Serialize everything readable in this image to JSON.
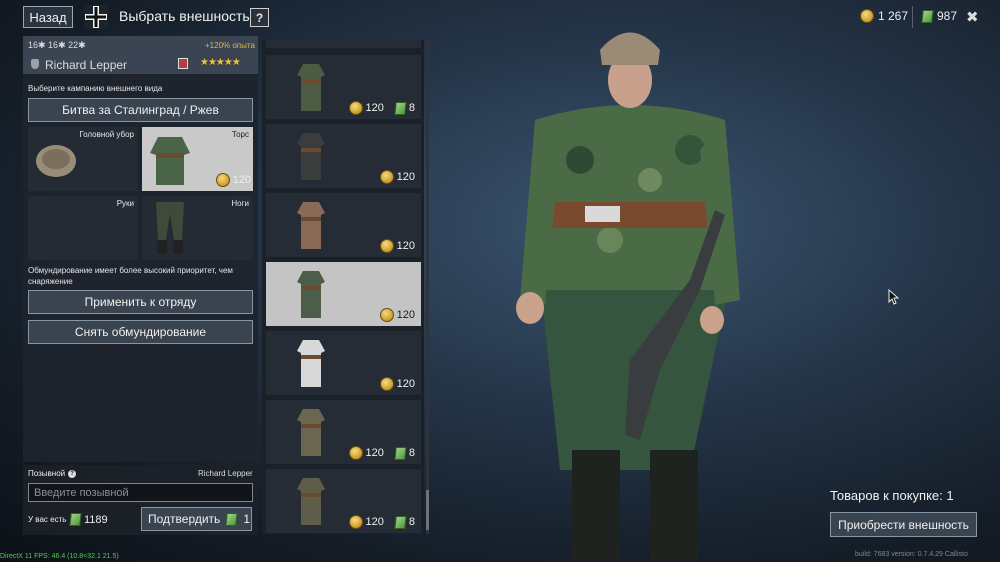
{
  "header": {
    "back_label": "Назад",
    "title": "Выбрать внешность",
    "help_label": "?",
    "silver_amount": "1 267",
    "gold_amount": "987",
    "close_label": "✖"
  },
  "soldier": {
    "stats": "16✱ 16✱ 22✱",
    "bonus": "+120% опыта",
    "name": "Richard Lepper",
    "stars": "★★★★★"
  },
  "campaign": {
    "label": "Выберите кампанию внешнего вида",
    "selected": "Битва за Сталинград / Ржев"
  },
  "slots": {
    "headgear": "Головной убор",
    "torso": "Торс",
    "torso_price": "120",
    "hands": "Руки",
    "legs": "Ноги"
  },
  "priority_note": "Обмундирование имеет более высокий приоритет, чем снаряжение",
  "actions": {
    "apply": "Применить к отряду",
    "remove": "Снять обмундирование"
  },
  "callsign": {
    "label": "Позывной",
    "name": "Richard Lepper",
    "placeholder": "Введите позывной",
    "have_label": "У вас есть",
    "have_amount": "1189",
    "confirm_label": "Подтвердить",
    "confirm_amount": "1"
  },
  "items": [
    {
      "silver": "120",
      "gold": "8",
      "color": "#4d5a44"
    },
    {
      "silver": "120",
      "gold": "",
      "color": "#3b3d3c"
    },
    {
      "silver": "120",
      "gold": "",
      "color": "#8a6a56"
    },
    {
      "silver": "120",
      "gold": "",
      "color": "#4c5e4a",
      "selected": true
    },
    {
      "silver": "120",
      "gold": "",
      "color": "#d8d8d8"
    },
    {
      "silver": "120",
      "gold": "8",
      "color": "#6b6650"
    },
    {
      "silver": "120",
      "gold": "8",
      "color": "#5e5d47"
    }
  ],
  "purchase": {
    "count_label": "Товаров к покупке: 1",
    "buy_label": "Приобрести внешность"
  },
  "footer": {
    "fps": "DirectX 11 FPS: 46.4 (10.8<32.1 21.5)",
    "build": "build: 7683 version: 0.7.4.29 Callisto"
  }
}
